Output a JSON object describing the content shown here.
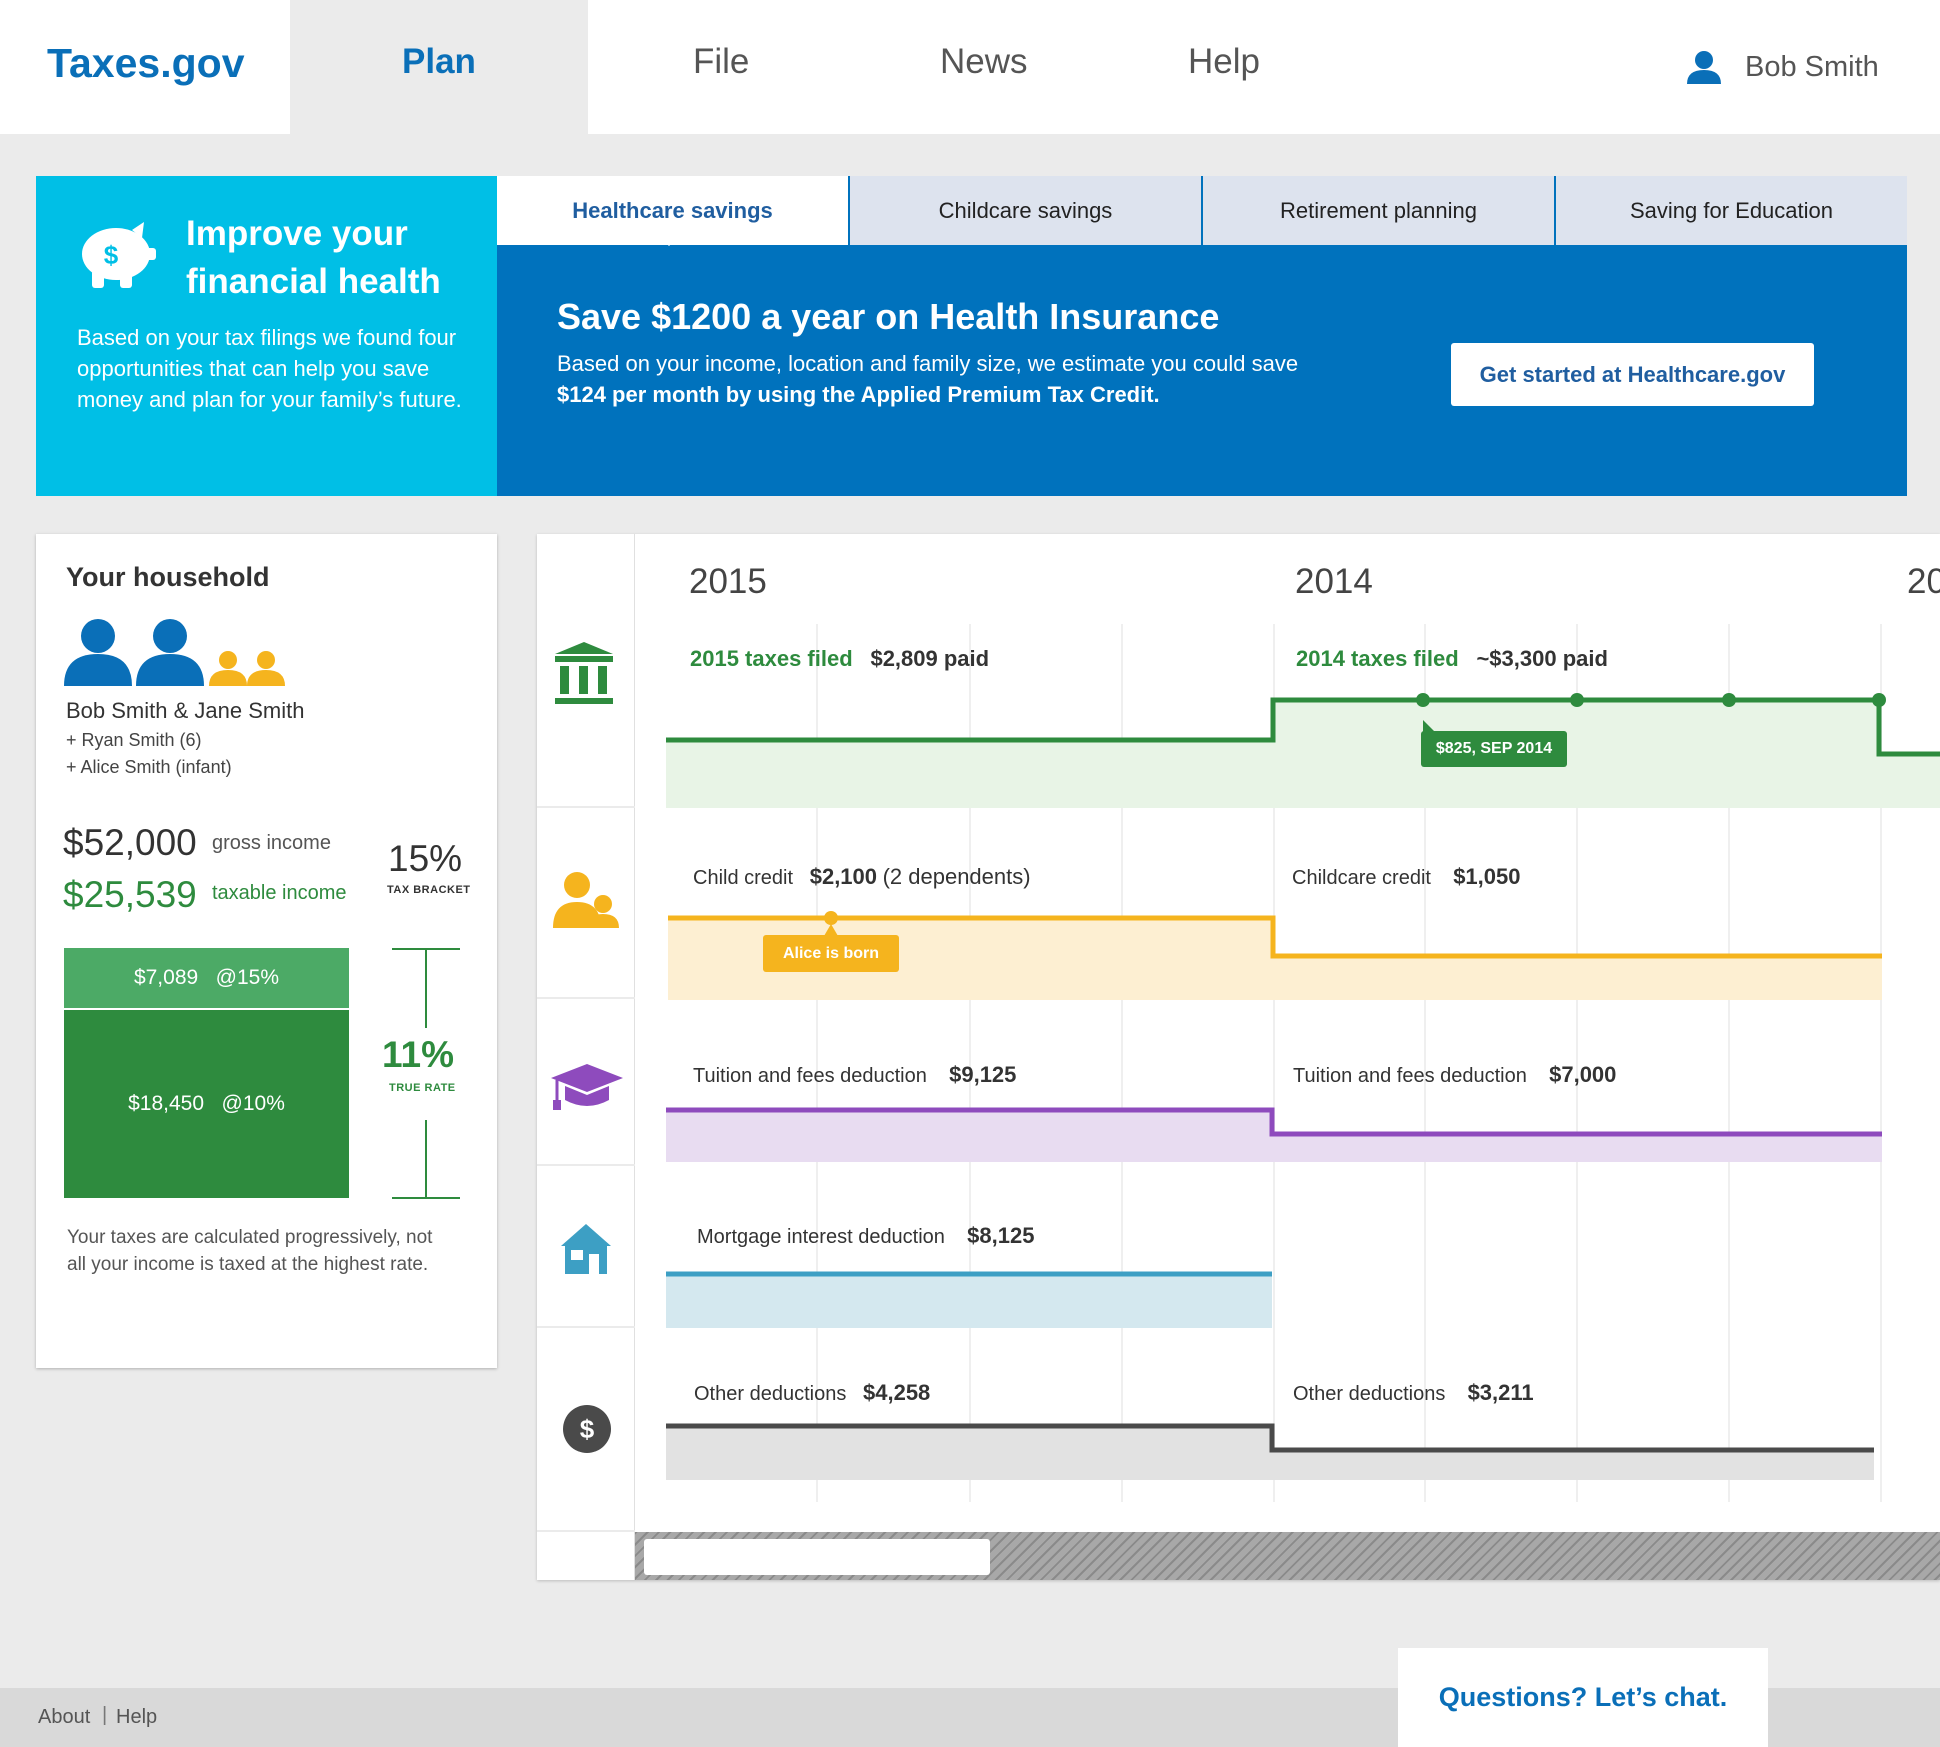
{
  "nav": {
    "logo": "Taxes.gov",
    "items": [
      "Plan",
      "File",
      "News",
      "Help"
    ],
    "user": "Bob Smith"
  },
  "promo": {
    "title": "Improve your financial health",
    "text": "Based on your tax filings we found four opportunities that can help you save money and plan for your family’s future."
  },
  "tabs": [
    "Healthcare savings",
    "Childcare savings",
    "Retirement planning",
    "Saving for Education"
  ],
  "savings": {
    "title": "Save $1200 a year on Health Insurance",
    "text": "Based on your income, location and family size, we estimate you could save",
    "text_strong": "$124 per month by using the Applied Premium Tax Credit.",
    "cta": "Get started at Healthcare.gov"
  },
  "household": {
    "title": "Your household",
    "names": "Bob Smith & Jane Smith",
    "child1": "+ Ryan Smith (6)",
    "child2": "+ Alice Smith (infant)",
    "gross_value": "$52,000",
    "gross_label": "gross income",
    "taxable_value": "$25,539",
    "taxable_label": "taxable income",
    "bracket_value": "15%",
    "bracket_label": "TAX BRACKET",
    "bar_top": "$7,089   @15%",
    "bar_bottom": "$18,450   @10%",
    "true_rate_value": "11%",
    "true_rate_label": "TRUE RATE",
    "note": "Your taxes are calculated progressively, not all your income is taxed at the highest rate."
  },
  "timeline": {
    "years": [
      "2015",
      "2014",
      "20"
    ],
    "taxes": {
      "y2015_label": "2015 taxes filed",
      "y2015_value": "$2,809 paid",
      "y2014_label": "2014 taxes filed",
      "y2014_value": "~$3,300 paid",
      "tooltip": "$825, SEP 2014"
    },
    "child": {
      "y2015_label": "Child credit",
      "y2015_value": "$2,100",
      "y2015_extra": "(2 dependents)",
      "y2014_label": "Childcare credit",
      "y2014_value": "$1,050",
      "tooltip": "Alice is born"
    },
    "tuition": {
      "y2015_label": "Tuition and fees deduction",
      "y2015_value": "$9,125",
      "y2014_label": "Tuition and fees deduction",
      "y2014_value": "$7,000"
    },
    "mortgage": {
      "y2015_label": "Mortgage interest deduction",
      "y2015_value": "$8,125"
    },
    "other": {
      "y2015_label": "Other deductions",
      "y2015_value": "$4,258",
      "y2014_label": "Other deductions",
      "y2014_value": "$3,211"
    }
  },
  "colors": {
    "brand": "#0a6fb8",
    "promo": "#00bfe6",
    "banner": "#0072bd",
    "taxes": "#2e8b3e",
    "child": "#f5b41e",
    "tuition": "#8e4bbd",
    "mortgage": "#3d9fc4",
    "other": "#4a4a4a"
  },
  "footer": {
    "about": "About",
    "help": "Help",
    "chat": "Questions? Let’s chat."
  }
}
